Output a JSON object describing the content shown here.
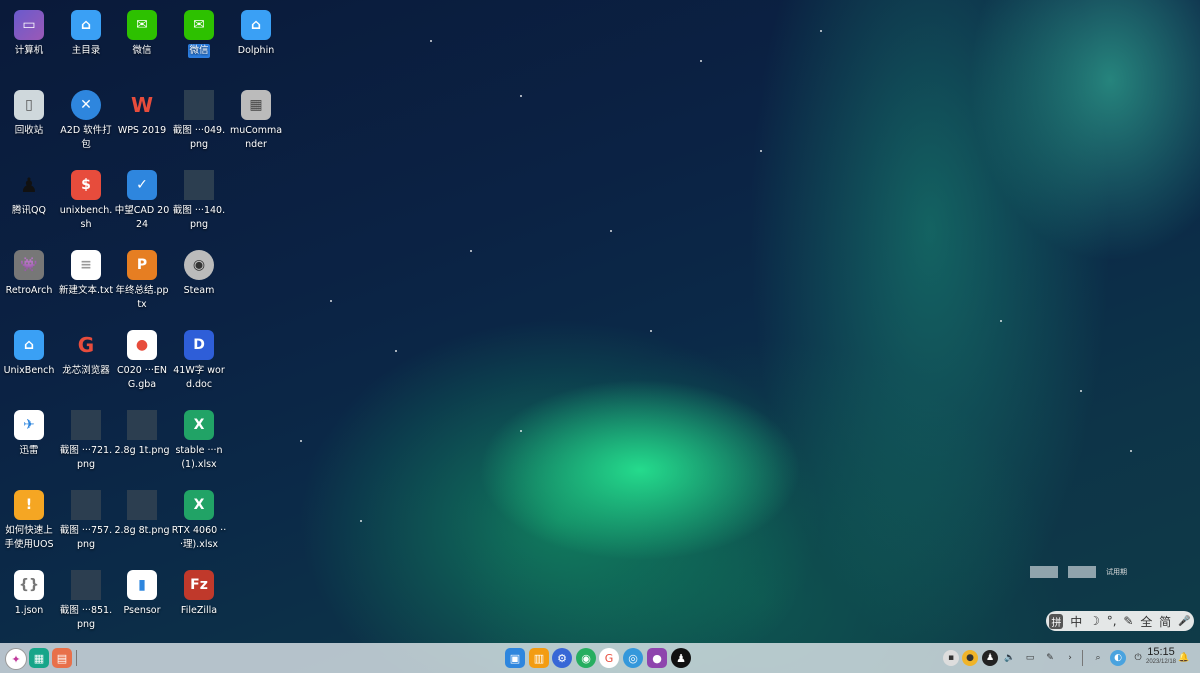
{
  "desktop": {
    "icons": [
      {
        "label": "计算机",
        "icon": "computer-icon"
      },
      {
        "label": "主目录",
        "icon": "home-folder-icon"
      },
      {
        "label": "微信",
        "icon": "wechat-icon"
      },
      {
        "label": "微信",
        "icon": "wechat-icon"
      },
      {
        "label": "Dolphin",
        "icon": "folder-icon"
      },
      {
        "label": "回收站",
        "icon": "trash-icon"
      },
      {
        "label": "A2D 软件打包",
        "icon": "a2d-icon"
      },
      {
        "label": "WPS 2019",
        "icon": "wps-icon"
      },
      {
        "label": "截图 ···049.png",
        "icon": "image-thumb-icon"
      },
      {
        "label": "muCommander",
        "icon": "mucommander-icon"
      },
      {
        "label": "腾讯QQ",
        "icon": "qq-icon"
      },
      {
        "label": "unixbench.sh",
        "icon": "shell-script-icon"
      },
      {
        "label": "中望CAD 2024",
        "icon": "cad-icon"
      },
      {
        "label": "截图 ···140.png",
        "icon": "image-thumb-icon"
      },
      {
        "label": "RetroArch",
        "icon": "retroarch-icon"
      },
      {
        "label": "新建文本.txt",
        "icon": "text-file-icon"
      },
      {
        "label": "年终总结.pptx",
        "icon": "pptx-icon"
      },
      {
        "label": "Steam",
        "icon": "steam-icon"
      },
      {
        "label": "UnixBench",
        "icon": "folder-icon"
      },
      {
        "label": "龙芯浏览器",
        "icon": "loongson-browser-icon"
      },
      {
        "label": "C020 ···ENG.gba",
        "icon": "gba-file-icon"
      },
      {
        "label": "41W字 word.doc",
        "icon": "word-doc-icon"
      },
      {
        "label": "迅雷",
        "icon": "xunlei-icon"
      },
      {
        "label": "截图 ···721.png",
        "icon": "image-thumb-icon"
      },
      {
        "label": "2.8g 1t.png",
        "icon": "image-thumb-icon"
      },
      {
        "label": "stable ···n(1).xlsx",
        "icon": "xlsx-icon"
      },
      {
        "label": "如何快速上手使用UOS",
        "icon": "uos-guide-icon"
      },
      {
        "label": "截图 ···757.png",
        "icon": "image-thumb-icon"
      },
      {
        "label": "2.8g 8t.png",
        "icon": "image-thumb-icon"
      },
      {
        "label": "RTX 4060 ···理).xlsx",
        "icon": "xlsx-icon"
      },
      {
        "label": "1.json",
        "icon": "json-file-icon"
      },
      {
        "label": "截图 ···851.png",
        "icon": "image-thumb-icon"
      },
      {
        "label": "Psensor",
        "icon": "psensor-icon"
      },
      {
        "label": "FileZilla",
        "icon": "filezilla-icon"
      }
    ]
  },
  "watermark": {
    "label": "试用期"
  },
  "ime": {
    "items": [
      "拼",
      "中",
      "☽",
      "°,",
      "✎",
      "全",
      "简",
      "🎤"
    ]
  },
  "taskbar": {
    "launcher": "launcher-icon",
    "pinned": [
      "multitask-view-icon",
      "show-desktop-icon"
    ],
    "apps": [
      "file-manager-icon",
      "app-store-icon",
      "settings-icon",
      "browser-icon",
      "loongson-browser-icon",
      "uos-browser-icon",
      "media-player-icon",
      "qq-icon"
    ],
    "tray": [
      "tray-app-icon",
      "tray-notify-icon",
      "tray-qq-icon",
      "volume-icon",
      "network-icon",
      "pen-icon",
      "expand-icon",
      "search-icon",
      "color-picker-icon",
      "power-icon"
    ],
    "clock": {
      "time": "15:15",
      "date": "2023/12/18"
    },
    "notification": "notification-icon"
  }
}
